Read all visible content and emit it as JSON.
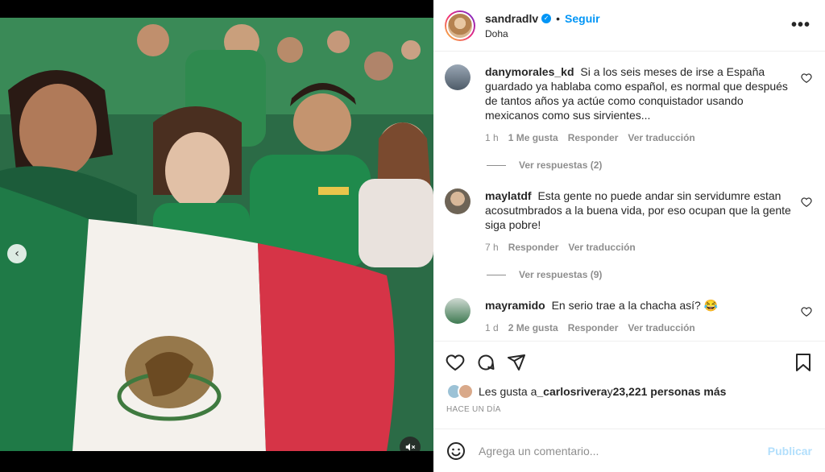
{
  "post": {
    "username": "sandradlv",
    "separator": "•",
    "follow_label": "Seguir",
    "location": "Doha",
    "more_label": "•••"
  },
  "media": {
    "prev_glyph": "‹",
    "active_dot": 6,
    "dot_count": 8
  },
  "comments": [
    {
      "username": "danymorales_kd",
      "text": "Si a los seis meses de irse a España guardado ya hablaba como español, es normal que después de tantos años ya actúe como conquistador usando mexicanos como sus sirvientes...",
      "time": "1 h",
      "likes": "1 Me gusta",
      "reply": "Responder",
      "translate": "Ver traducción",
      "view_replies": "Ver respuestas (2)",
      "avatar_color": "#6b7b8c"
    },
    {
      "username": "maylatdf",
      "text": "Esta gente no puede andar sin servidumre estan acosutmbrados a la buena vida, por eso ocupan que la gente siga pobre!",
      "time": "7 h",
      "likes": "",
      "reply": "Responder",
      "translate": "Ver traducción",
      "view_replies": "Ver respuestas (9)",
      "avatar_color": "#8a7a6a"
    },
    {
      "username": "mayramido",
      "text": "En serio trae a la chacha así? 😂",
      "time": "1 d",
      "likes": "2 Me gusta",
      "reply": "Responder",
      "translate": "Ver traducción",
      "view_replies": "",
      "avatar_color": "#5f8a6a"
    }
  ],
  "likes": {
    "prefix": "Les gusta a ",
    "first_user": "_carlosrivera",
    "middle": " y ",
    "others": "23,221 personas más"
  },
  "timeago": "HACE UN DÍA",
  "add_comment": {
    "placeholder": "Agrega un comentario...",
    "publish_label": "Publicar"
  },
  "colors": {
    "accent": "#0095f6",
    "publish_disabled": "#b2dffc",
    "flag_green": "#1f7a47",
    "flag_white": "#f4f1ec",
    "flag_red": "#d63447"
  },
  "icons": [
    "heart-icon",
    "comment-icon",
    "share-icon",
    "bookmark-icon",
    "emoji-icon",
    "mute-icon",
    "verified-icon"
  ]
}
